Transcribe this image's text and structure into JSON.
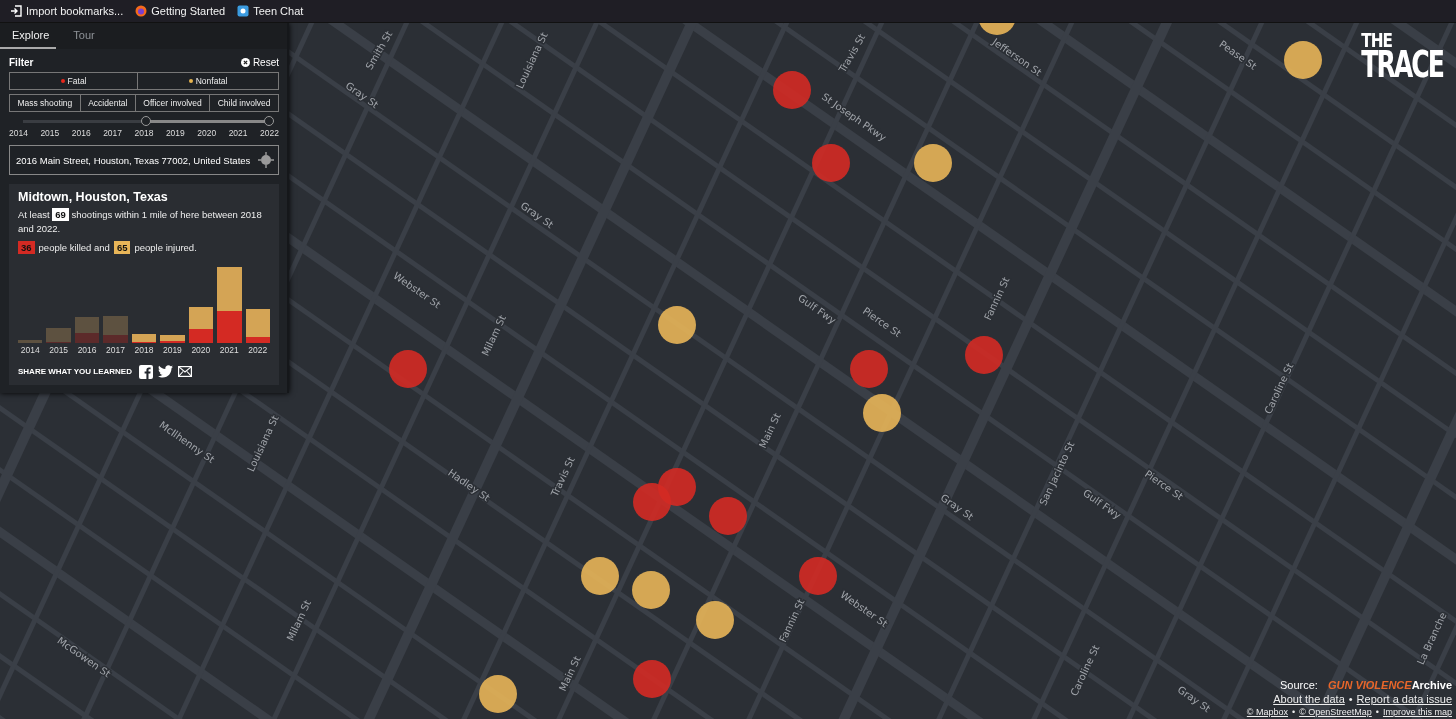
{
  "bookmarks": [
    {
      "label": "Import bookmarks...",
      "kind": "import"
    },
    {
      "label": "Getting Started",
      "kind": "browser"
    },
    {
      "label": "Teen Chat",
      "kind": "chat"
    }
  ],
  "tabs": [
    {
      "label": "Explore",
      "selected": true
    },
    {
      "label": "Tour",
      "selected": false
    }
  ],
  "filter": {
    "title": "Filter",
    "reset": "Reset",
    "outcomes": [
      {
        "label": "Fatal",
        "color": "#e8281c"
      },
      {
        "label": "Nonfatal",
        "color": "#e6b450"
      }
    ],
    "types": [
      "Mass shooting",
      "Accidental",
      "Officer involved",
      "Child involved"
    ],
    "years": [
      "2014",
      "2015",
      "2016",
      "2017",
      "2018",
      "2019",
      "2020",
      "2021",
      "2022"
    ],
    "range_handles": [
      {
        "level": 0.5
      },
      {
        "level": 1
      }
    ],
    "address": "2016 Main Street, Houston, Texas 77002, United States"
  },
  "summary": {
    "title": "Midtown, Houston, Texas",
    "line1_before": "At least",
    "total": "69",
    "line1_after": "shootings within 1 mile of here between 2018 and 2022.",
    "killed": "36",
    "killed_text": "people killed and",
    "injured": "65",
    "injured_text": "people injured.",
    "chart_years": [
      {
        "label": "2014",
        "selected": false
      },
      {
        "label": "2015",
        "selected": false
      },
      {
        "label": "2016",
        "selected": false
      },
      {
        "label": "2017",
        "selected": false
      },
      {
        "label": "2018",
        "selected": true
      },
      {
        "label": "2019",
        "selected": true
      },
      {
        "label": "2020",
        "selected": true
      },
      {
        "label": "2021",
        "selected": true
      },
      {
        "label": "2022",
        "selected": true
      }
    ],
    "share": "SHARE WHAT YOU LEARNED"
  },
  "logo": {
    "top": "THE",
    "bottom": "TRACE"
  },
  "streets": [
    "Smith St",
    "Louisiana St",
    "Travis St",
    "Jefferson St",
    "Pease St",
    "Gray St",
    "St Joseph Pkwy",
    "Gray St",
    "Webster St",
    "Milam St",
    "Gulf Fwy",
    "Pierce St",
    "Fannin St",
    "Caroline St",
    "McIlhenny St",
    "Louisiana St",
    "Hadley St",
    "Travis St",
    "Main St",
    "San Jacinto St",
    "Gulf Fwy",
    "Pierce St",
    "Gray St",
    "Webster St",
    "Fannin St",
    "Milam St",
    "McGowen St",
    "Main St",
    "Caroline St",
    "Gray St",
    "La Branche"
  ],
  "incidents": [
    {
      "kind": "nonfatal"
    },
    {
      "kind": "nonfatal"
    },
    {
      "kind": "fatal"
    },
    {
      "kind": "fatal"
    },
    {
      "kind": "nonfatal"
    },
    {
      "kind": "nonfatal"
    },
    {
      "kind": "fatal"
    },
    {
      "kind": "fatal"
    },
    {
      "kind": "fatal"
    },
    {
      "kind": "nonfatal"
    },
    {
      "kind": "fatal"
    },
    {
      "kind": "fatal"
    },
    {
      "kind": "fatal"
    },
    {
      "kind": "nonfatal"
    },
    {
      "kind": "nonfatal"
    },
    {
      "kind": "fatal"
    },
    {
      "kind": "nonfatal"
    },
    {
      "kind": "fatal"
    },
    {
      "kind": "nonfatal"
    }
  ],
  "source": {
    "label": "Source:",
    "brand": "GUN VIOLENCE",
    "brand_suffix": "Archive",
    "links": [
      "About the data",
      "Report a data issue"
    ],
    "credits": [
      "© Mapbox",
      "© OpenStreetMap",
      "Improve this map"
    ],
    "separator": "•"
  }
}
